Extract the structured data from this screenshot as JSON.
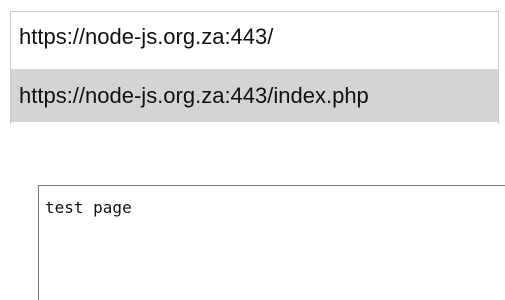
{
  "url_input": {
    "value": "https://node-js.org.za:443/"
  },
  "autocomplete": {
    "items": [
      {
        "label": "https://node-js.org.za:443/index.php",
        "highlighted": true
      }
    ],
    "highlight_color": "#d4d4d4"
  },
  "content_area": {
    "value": "test page"
  }
}
